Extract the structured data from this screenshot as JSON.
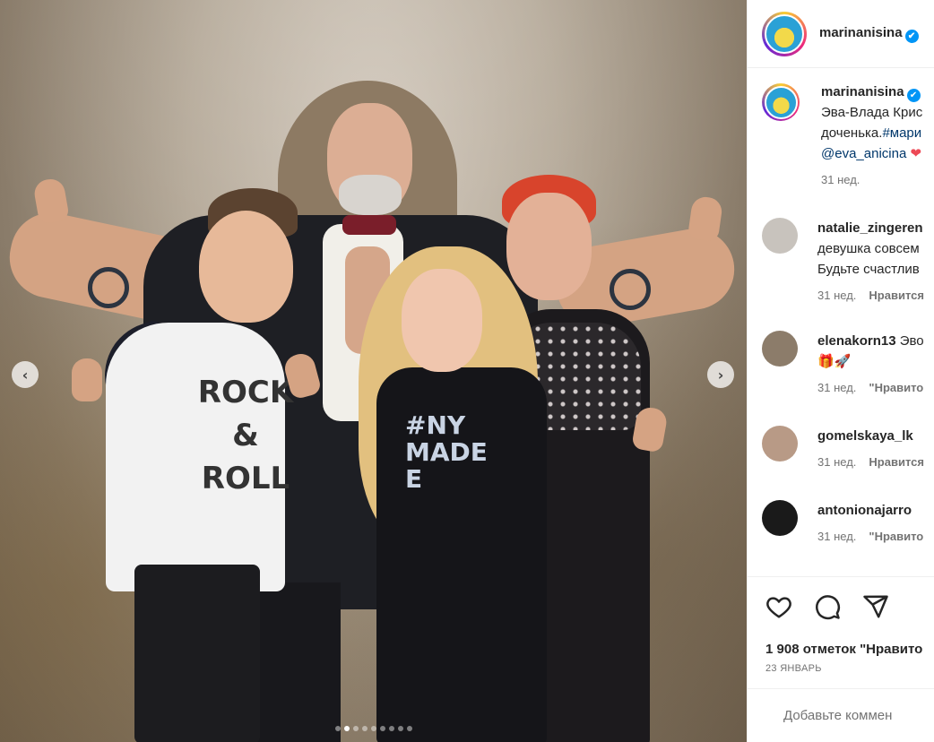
{
  "post": {
    "author": "marinanisina",
    "verified_mark": "✔",
    "image": {
      "shirt_text": "ROCK\n&\nROLL",
      "dress_text": "#NY\nMADE\nE",
      "slide_count": 9,
      "active_slide": 2,
      "prev_arrow": "‹",
      "next_arrow": "›"
    },
    "caption": {
      "username": "marinanisina",
      "line1": "Эва-Влада Крис",
      "line2_text": "доченька.",
      "line2_tag": "#мари",
      "line3_mention": "@eva_anicina",
      "heart": "❤",
      "time": "31 нед."
    },
    "comments": [
      {
        "username": "natalie_zingeren",
        "text_lines": [
          "девушка совсем",
          "Будьте счастлив"
        ],
        "time": "31 нед.",
        "action": "Нравится",
        "avatar_color": "#c8c3bd"
      },
      {
        "username": "elenakorn13",
        "text": "Эво",
        "emoji": "🎁🚀",
        "time": "31 нед.",
        "action": "\"Нравито",
        "avatar_color": "#8c7c6a"
      },
      {
        "username": "gomelskaya_lk",
        "time": "31 нед.",
        "action": "Нравится",
        "avatar_color": "#b89a86"
      },
      {
        "username": "antonionajarro",
        "time": "31 нед.",
        "action": "\"Нравито",
        "avatar_color": "#1a1a1a"
      }
    ],
    "likes_text": "1 908 отметок \"Нравито",
    "date_text": "23 ЯНВАРЬ",
    "comment_placeholder": "Добавьте коммен"
  },
  "icons": [
    "heart-icon",
    "comment-icon",
    "share-icon",
    "emoji-icon",
    "verified-icon"
  ],
  "colors": {
    "verified": "#0095f6",
    "link": "#00376b",
    "muted": "#737373",
    "heart": "#ed4956"
  }
}
